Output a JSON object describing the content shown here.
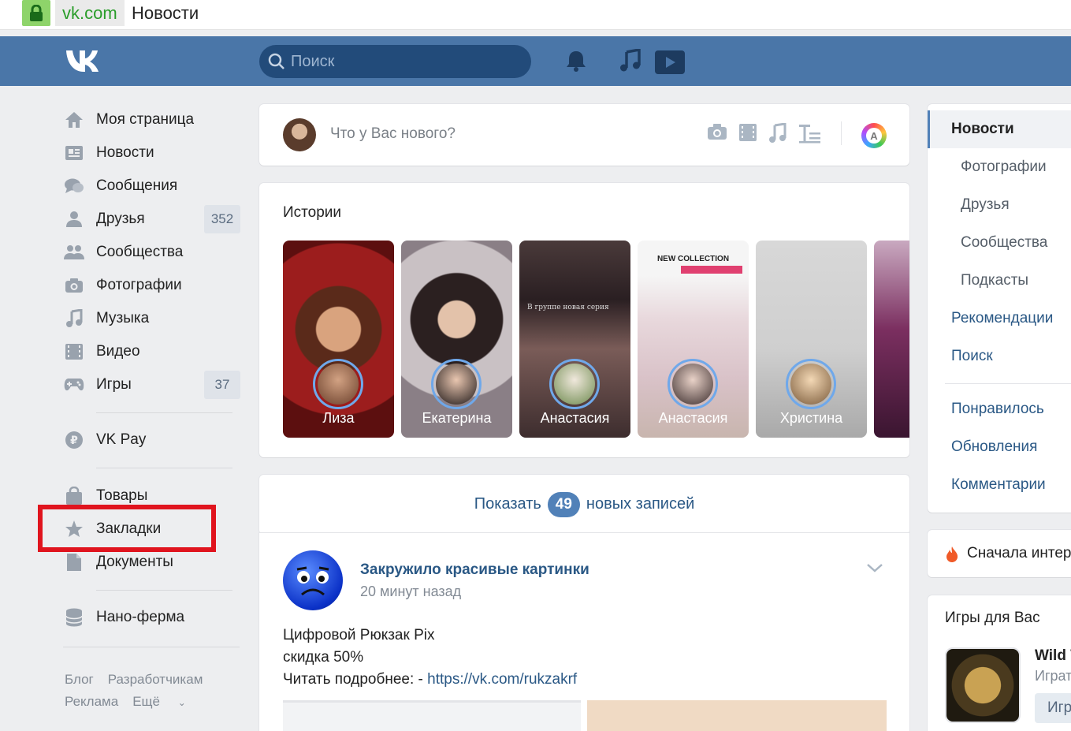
{
  "browser": {
    "domain": "vk.com",
    "page_title": "Новости"
  },
  "header": {
    "search_placeholder": "Поиск"
  },
  "left_menu": {
    "items": [
      {
        "label": "Моя страница"
      },
      {
        "label": "Новости"
      },
      {
        "label": "Сообщения"
      },
      {
        "label": "Друзья",
        "count": "352"
      },
      {
        "label": "Сообщества"
      },
      {
        "label": "Фотографии"
      },
      {
        "label": "Музыка"
      },
      {
        "label": "Видео"
      },
      {
        "label": "Игры",
        "count": "37"
      },
      {
        "label": "VK Pay"
      },
      {
        "label": "Товары"
      },
      {
        "label": "Закладки"
      },
      {
        "label": "Документы"
      },
      {
        "label": "Нано-ферма"
      }
    ],
    "footer": [
      "Блог",
      "Разработчикам",
      "Реклама",
      "Ещё"
    ]
  },
  "composer": {
    "placeholder": "Что у Вас нового?"
  },
  "stories": {
    "title": "Истории",
    "items": [
      {
        "name": "Лиза"
      },
      {
        "name": "Екатерина"
      },
      {
        "name": "Анастасия"
      },
      {
        "name": "Анастасия"
      },
      {
        "name": "Христина"
      }
    ],
    "texts": [
      "NEW COLLECTION",
      "В группе новая серия"
    ]
  },
  "show_new": {
    "prefix": "Показать",
    "count": "49",
    "suffix": "новых записей"
  },
  "post": {
    "author": "Закружило красивые картинки",
    "time": "20 минут назад",
    "lines": [
      "Цифровой Рюкзак Pix",
      "скидка 50%",
      "Читать подробнее: - "
    ],
    "link": "https://vk.com/rukzakrf"
  },
  "right_nav": {
    "active": "Новости",
    "sub": [
      "Фотографии",
      "Друзья",
      "Сообщества",
      "Подкасты"
    ],
    "main": [
      "Рекомендации",
      "Поиск"
    ],
    "extra": [
      "Понравилось",
      "Обновления",
      "Комментарии"
    ]
  },
  "sort": {
    "label": "Сначала интересные"
  },
  "games": {
    "title": "Игры для Вас",
    "name": "Wild Tanks",
    "subtitle": "Играть",
    "button": "Играть"
  },
  "colors": {
    "header": "#4a76a8",
    "link": "#2a5885",
    "highlight_box": "#e0141e"
  }
}
